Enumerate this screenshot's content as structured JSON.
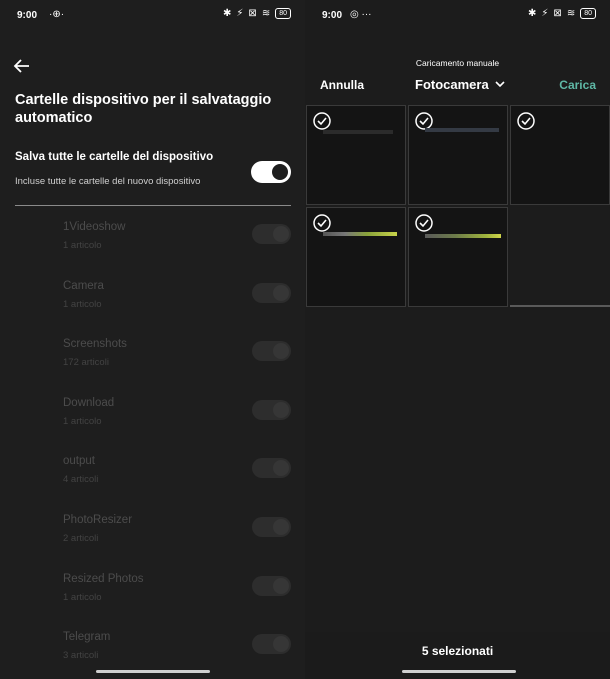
{
  "left": {
    "status": {
      "time": "9:00",
      "extra_icon": "·⊕·",
      "battery": "80"
    },
    "title": "Cartelle dispositivo per il salvataggio automatico",
    "save_all": {
      "label": "Salva tutte le cartelle del dispositivo",
      "sublabel": "Incluse tutte le cartelle del nuovo dispositivo",
      "enabled": true
    },
    "folders": [
      {
        "name": "1Videoshow",
        "count": "1 articolo"
      },
      {
        "name": "Camera",
        "count": "1 articolo"
      },
      {
        "name": "Screenshots",
        "count": "172 articoli"
      },
      {
        "name": "Download",
        "count": "1 articolo"
      },
      {
        "name": "output",
        "count": "4 articoli"
      },
      {
        "name": "PhotoResizer",
        "count": "2 articoli"
      },
      {
        "name": "Resized Photos",
        "count": "1 articolo"
      },
      {
        "name": "Telegram",
        "count": "3 articoli"
      }
    ]
  },
  "right": {
    "status": {
      "time": "9:00",
      "extra_icon": "◎ ···",
      "battery": "80"
    },
    "subtitle": "Caricamento manuale",
    "cancel_label": "Annulla",
    "album_label": "Fotocamera",
    "upload_label": "Carica",
    "selected_count_label": "5 selezionati",
    "accent_color": "#5fb8a6"
  }
}
